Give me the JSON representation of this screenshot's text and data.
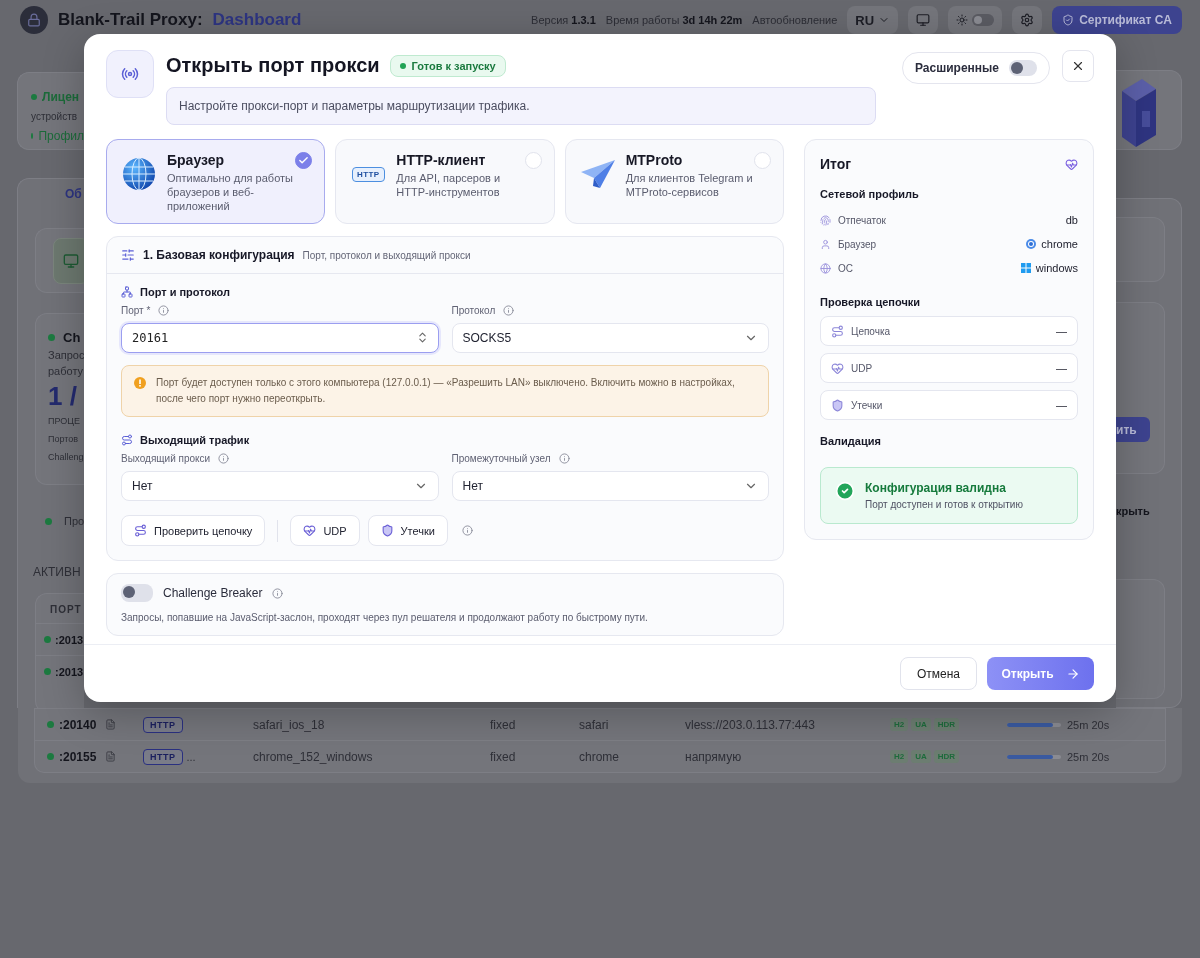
{
  "background": {
    "header": {
      "product": "Blank-Trail Proxy:",
      "page": "Dashboard",
      "version_label": "Версия",
      "version": "1.3.1",
      "uptime_label": "Время работы",
      "uptime": "3d 14h 22m",
      "autorefresh": "Автообновление",
      "language": "RU",
      "theme_on": false,
      "ca_button": "Сертификат CA"
    },
    "left": {
      "license": "Лицен",
      "devices": "устройств",
      "profile": "Профил",
      "tab": "Об",
      "challenge_title": "Ch",
      "challenge_lines": [
        "Запрос",
        "работу"
      ],
      "counter": "1 /",
      "counter_label": "ПРОЦЕ",
      "stats": [
        "Портов",
        "Challeng"
      ],
      "proxy_note": "Про",
      "section": "АКТИВН",
      "column": "ПОРТ",
      "ports": [
        ":2013",
        ":2013"
      ]
    },
    "right": {
      "button": "ить",
      "note": "крыть"
    },
    "rows": [
      {
        "port": ":20140",
        "type": "HTTP",
        "profile": "safari_ios_18",
        "mode": "fixed",
        "browser": "safari",
        "route": "vless://203.0.113.77:443",
        "tags": [
          "H2",
          "UA",
          "HDR"
        ],
        "level": 0.85,
        "time": "25m 20s"
      },
      {
        "port": ":20155",
        "type": "HTTP",
        "extra": "...",
        "profile": "chrome_152_windows",
        "mode": "fixed",
        "browser": "chrome",
        "route": "напрямую",
        "tags": [
          "H2",
          "UA",
          "HDR"
        ],
        "level": 0.85,
        "time": "25m 20s"
      }
    ]
  },
  "modal": {
    "title": "Открыть порт прокси",
    "status": "Готов к запуску",
    "advanced": {
      "label": "Расширенные",
      "on": false
    },
    "description": "Настройте прокси-порт и параметры маршрутизации трафика.",
    "modes": [
      {
        "kind": "globe",
        "title": "Браузер",
        "text": "Оптимально для работы браузеров и веб-приложений",
        "selected": true
      },
      {
        "kind": "http",
        "badge": "HTTP",
        "title": "HTTP-клиент",
        "text": "Для API, парсеров и HTTP-инструментов",
        "selected": false
      },
      {
        "kind": "plane",
        "title": "MTProto",
        "text": "Для клиентов Telegram и MTProto-сервисов",
        "selected": false
      }
    ],
    "section": {
      "title": "1. Базовая конфигурация",
      "subtitle": "Порт, протокол и выходящий прокси"
    },
    "port_group": {
      "title": "Порт и протокол",
      "port": {
        "label": "Порт *",
        "value": "20161"
      },
      "protocol": {
        "label": "Протокол",
        "value": "SOCKS5"
      }
    },
    "warning": "Порт будет доступен только с этого компьютера (127.0.0.1) — «Разрешить LAN» выключено. Включить можно в настройках, после чего порт нужно переоткрыть.",
    "traffic": {
      "title": "Выходящий трафик",
      "outbound": {
        "label": "Выходящий прокси",
        "value": "Нет"
      },
      "relay": {
        "label": "Промежуточный узел",
        "value": "Нет"
      }
    },
    "actions": [
      {
        "kind": "chain",
        "label": "Проверить цепочку"
      },
      {
        "kind": "udp",
        "label": "UDP"
      },
      {
        "kind": "leaks",
        "label": "Утечки"
      }
    ],
    "challenge": {
      "label": "Challenge Breaker",
      "on": false,
      "text": "Запросы, попавшие на JavaScript-заслон, проходят через пул решателя и продолжают работу по быстрому пути."
    },
    "summary": {
      "title": "Итог",
      "profile_title": "Сетевой профиль",
      "profile": [
        {
          "kind": "fingerprint",
          "label": "Отпечаток",
          "value": "db"
        },
        {
          "kind": "browser",
          "label": "Браузер",
          "value": "chrome"
        },
        {
          "kind": "os",
          "label": "ОС",
          "value": "windows"
        }
      ],
      "chain_title": "Проверка цепочки",
      "checks": [
        {
          "kind": "chain",
          "label": "Цепочка",
          "value": "—"
        },
        {
          "kind": "udp",
          "label": "UDP",
          "value": "—"
        },
        {
          "kind": "leaks",
          "label": "Утечки",
          "value": "—"
        }
      ],
      "validation_title": "Валидация",
      "validation": {
        "ok": true,
        "title": "Конфигурация валидна",
        "text": "Порт доступен и готов к открытию"
      }
    },
    "footer": {
      "cancel": "Отмена",
      "submit": "Открыть"
    }
  }
}
